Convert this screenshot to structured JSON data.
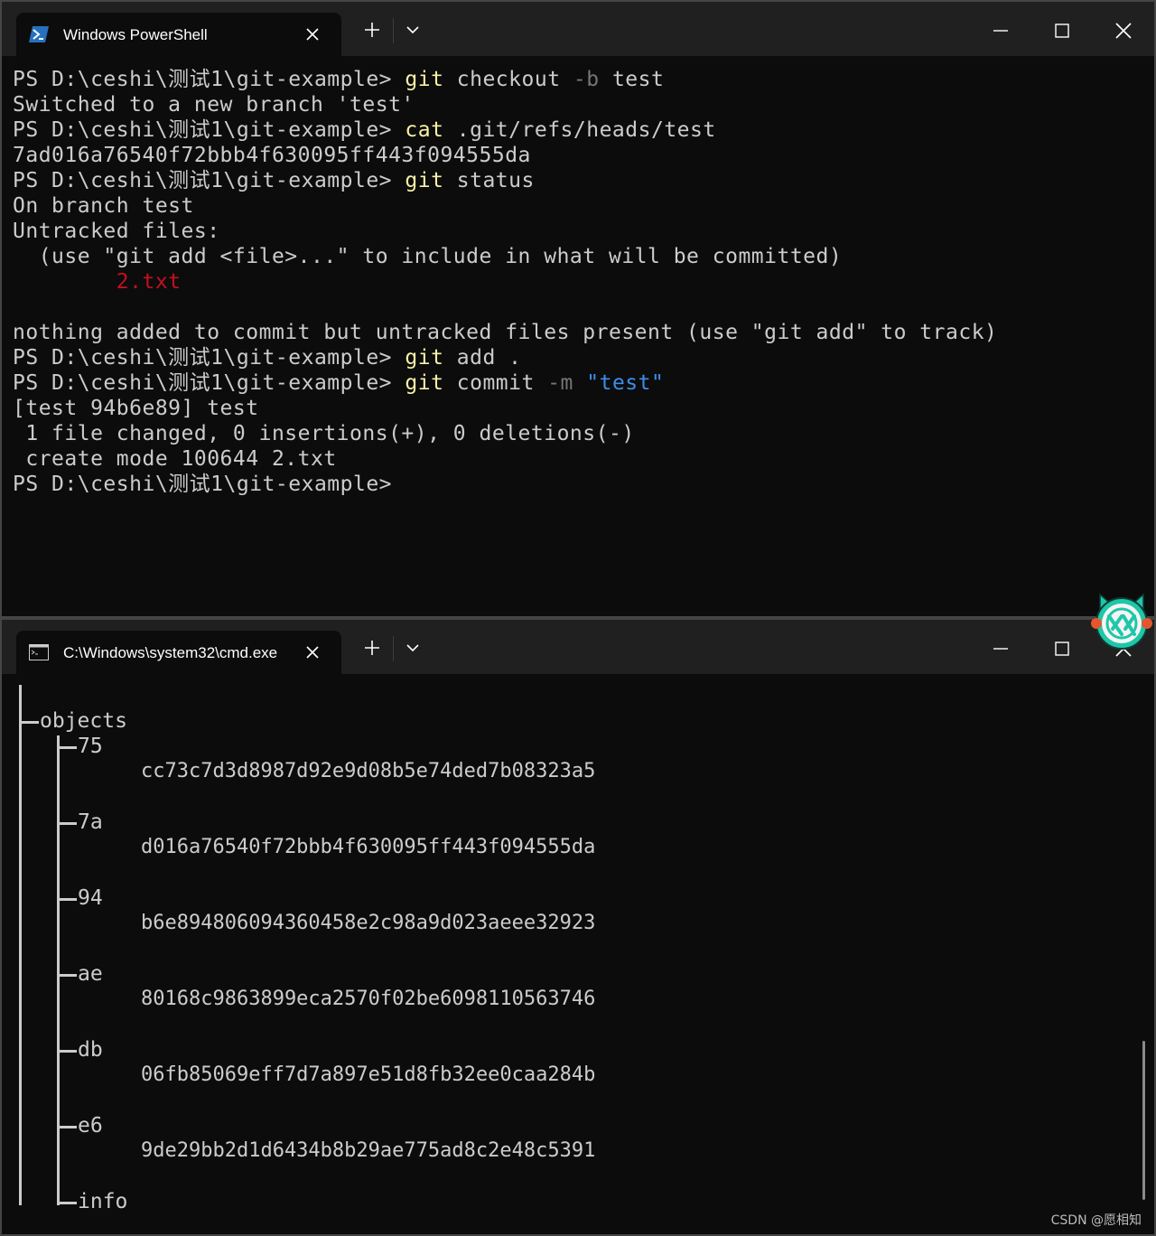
{
  "powershell_window": {
    "tab_title": "Windows PowerShell",
    "lines": [
      [
        {
          "t": "PS D:\\ceshi\\测试1\\git-example> ",
          "c": ""
        },
        {
          "t": "git",
          "c": "cmd"
        },
        {
          "t": " checkout ",
          "c": ""
        },
        {
          "t": "-b",
          "c": "flag"
        },
        {
          "t": " test",
          "c": ""
        }
      ],
      [
        {
          "t": "Switched to a new branch 'test'",
          "c": ""
        }
      ],
      [
        {
          "t": "PS D:\\ceshi\\测试1\\git-example> ",
          "c": ""
        },
        {
          "t": "cat",
          "c": "cmd"
        },
        {
          "t": " .git/refs/heads/test",
          "c": ""
        }
      ],
      [
        {
          "t": "7ad016a76540f72bbb4f630095ff443f094555da",
          "c": ""
        }
      ],
      [
        {
          "t": "PS D:\\ceshi\\测试1\\git-example> ",
          "c": ""
        },
        {
          "t": "git",
          "c": "cmd"
        },
        {
          "t": " status",
          "c": ""
        }
      ],
      [
        {
          "t": "On branch test",
          "c": ""
        }
      ],
      [
        {
          "t": "Untracked files:",
          "c": ""
        }
      ],
      [
        {
          "t": "  (use \"git add <file>...\" to include in what will be committed)",
          "c": ""
        }
      ],
      [
        {
          "t": "        ",
          "c": ""
        },
        {
          "t": "2.txt",
          "c": "untracked"
        }
      ],
      [
        {
          "t": "",
          "c": ""
        }
      ],
      [
        {
          "t": "nothing added to commit but untracked files present (use \"git add\" to track)",
          "c": ""
        }
      ],
      [
        {
          "t": "PS D:\\ceshi\\测试1\\git-example> ",
          "c": ""
        },
        {
          "t": "git",
          "c": "cmd"
        },
        {
          "t": " add .",
          "c": ""
        }
      ],
      [
        {
          "t": "PS D:\\ceshi\\测试1\\git-example> ",
          "c": ""
        },
        {
          "t": "git",
          "c": "cmd"
        },
        {
          "t": " commit ",
          "c": ""
        },
        {
          "t": "-m",
          "c": "flag"
        },
        {
          "t": " ",
          "c": ""
        },
        {
          "t": "\"test\"",
          "c": "str"
        }
      ],
      [
        {
          "t": "[test 94b6e89] test",
          "c": ""
        }
      ],
      [
        {
          "t": " 1 file changed, 0 insertions(+), 0 deletions(-)",
          "c": ""
        }
      ],
      [
        {
          "t": " create mode 100644 2.txt",
          "c": ""
        }
      ],
      [
        {
          "t": "PS D:\\ceshi\\测试1\\git-example>",
          "c": ""
        }
      ]
    ]
  },
  "cmd_window": {
    "tab_title": "C:\\Windows\\system32\\cmd.exe",
    "tree": {
      "root": "objects",
      "folders": [
        {
          "name": "75",
          "hash": "cc73c7d3d8987d92e9d08b5e74ded7b08323a5"
        },
        {
          "name": "7a",
          "hash": "d016a76540f72bbb4f630095ff443f094555da"
        },
        {
          "name": "94",
          "hash": "b6e894806094360458e2c98a9d023aeee32923"
        },
        {
          "name": "ae",
          "hash": "80168c9863899eca2570f02be6098110563746"
        },
        {
          "name": "db",
          "hash": "06fb85069eff7d7a897e51d8fb32ee0caa284b"
        },
        {
          "name": "e6",
          "hash": "9de29bb2d1d6434b8b29ae775ad8c2e48c5391"
        }
      ],
      "last": "info"
    }
  },
  "watermark": "CSDN @愿相知",
  "icons": {
    "ps_tab": "powershell-icon",
    "cmd_tab": "cmd-icon",
    "close": "close-icon",
    "new_tab": "plus-icon",
    "dropdown": "chevron-down-icon",
    "minimize": "minimize-icon",
    "maximize": "maximize-icon",
    "window_close": "window-close-icon"
  },
  "colors": {
    "terminal_bg": "#0c0c0c",
    "text": "#cccccc",
    "command": "#f9f1a5",
    "flag": "#767676",
    "string": "#3b8eea",
    "error": "#c50f1f"
  }
}
